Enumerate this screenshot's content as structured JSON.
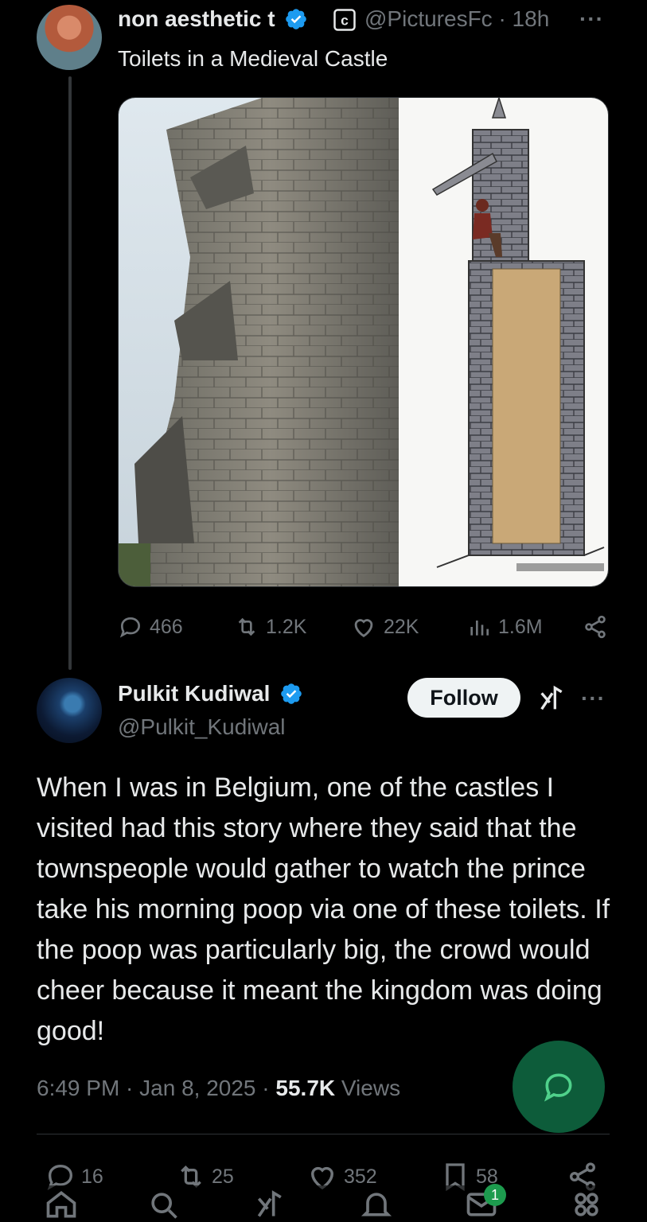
{
  "original_tweet": {
    "display_name": "non aesthetic t",
    "handle": "@PicturesFc",
    "time_ago": "· 18h",
    "text": "Toilets in a Medieval Castle",
    "more": "···",
    "stats": {
      "replies": "466",
      "retweets": "1.2K",
      "likes": "22K",
      "views": "1.6M"
    }
  },
  "reply_tweet": {
    "display_name": "Pulkit Kudiwal",
    "handle": "@Pulkit_Kudiwal",
    "follow_label": "Follow",
    "more": "···",
    "text": "When I was in Belgium, one of the castles I visited had this story where they said that the townspeople would gather to watch the prince take his morning poop via one of these toilets. If the poop was particularly big, the crowd would cheer because it meant the kingdom was doing good!",
    "time": "6:49 PM · Jan 8, 2025 · ",
    "views_count": "55.7K",
    "views_label": " Views",
    "stats": {
      "replies": "16",
      "retweets": "25",
      "likes": "352",
      "bookmarks": "58"
    }
  },
  "tabbar": {
    "notifications_badge": "1",
    "tabs": [
      "home-icon",
      "search-icon",
      "grok-icon",
      "notifications-icon",
      "messages-icon",
      "communities-icon"
    ]
  },
  "colors": {
    "background": "#000000",
    "text": "#e7e9ea",
    "muted": "#71767b",
    "verified": "#1d9bf0",
    "fab": "#0d5c3a"
  }
}
